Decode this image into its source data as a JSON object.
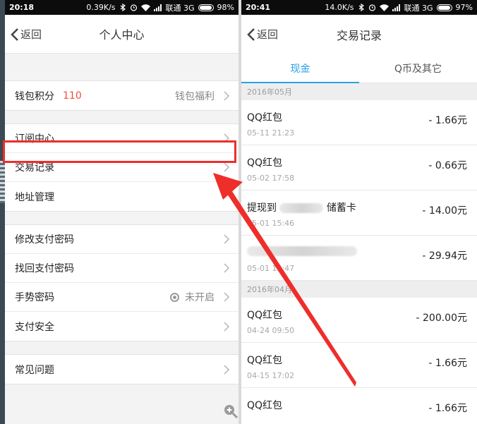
{
  "left": {
    "status": {
      "time": "20:18",
      "speed": "0.39K/s",
      "carrier": "联通 3G",
      "battery": "98%",
      "battery_level": 0.98
    },
    "title": "个人中心",
    "back_label": "返回",
    "wallet": {
      "label": "钱包积分",
      "points": "110",
      "benefit": "钱包福利"
    },
    "items": {
      "subscribe": "订阅中心",
      "transactions": "交易记录",
      "address": "地址管理",
      "change_pwd": "修改支付密码",
      "recover_pwd": "找回支付密码",
      "gesture": "手势密码",
      "gesture_status": "未开启",
      "security": "支付安全",
      "faq": "常见问题"
    }
  },
  "right": {
    "status": {
      "time": "20:41",
      "speed": "14.0K/s",
      "carrier": "联通 3G",
      "battery": "97%",
      "battery_level": 0.97
    },
    "title": "交易记录",
    "back_label": "返回",
    "tabs": [
      "现金",
      "Q币及其它"
    ],
    "months": [
      "2016年05月",
      "2016年04月"
    ],
    "tx": [
      {
        "name": "QQ红包",
        "date": "05-11 21:23",
        "amount": "- 1.66元"
      },
      {
        "name": "QQ红包",
        "date": "05-02 17:58",
        "amount": "- 0.66元"
      },
      {
        "name_pre": "提现到",
        "name_post": "储蓄卡",
        "date": "05-01 15:46",
        "amount": "- 14.00元"
      },
      {
        "name": "",
        "date": "05-01 12:47",
        "amount": "- 29.94元"
      },
      {
        "name": "QQ红包",
        "date": "04-24 09:50",
        "amount": "- 200.00元"
      },
      {
        "name": "QQ红包",
        "date": "04-15 17:02",
        "amount": "- 1.66元"
      },
      {
        "name": "QQ红包",
        "date": "",
        "amount": "- 1.66元"
      }
    ]
  },
  "colors": {
    "accent": "#29a0e7",
    "highlight": "#ee2e2b",
    "points": "#f24e3a"
  }
}
